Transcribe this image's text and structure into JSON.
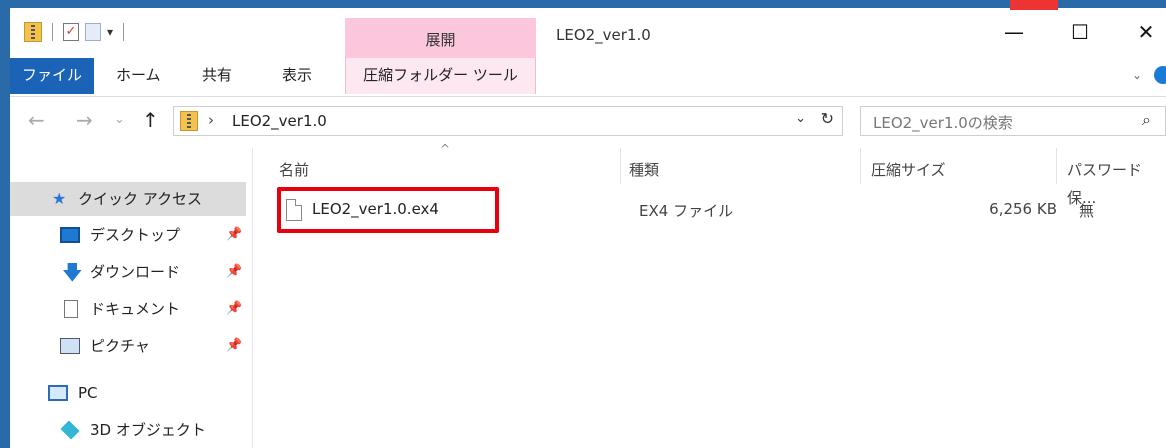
{
  "window": {
    "title": "LEO2_ver1.0",
    "contextual_tab_group": "展開",
    "controls": {
      "minimize": "—",
      "maximize": "☐",
      "close": "✕"
    }
  },
  "quick_access_toolbar": {
    "dropdown": "▾"
  },
  "ribbon": {
    "tabs": [
      {
        "label": "ファイル",
        "active": true
      },
      {
        "label": "ホーム"
      },
      {
        "label": "共有"
      },
      {
        "label": "表示"
      },
      {
        "label": "圧縮フォルダー ツール",
        "contextual": true
      }
    ],
    "collapse": "⌄"
  },
  "address_bar": {
    "back": "←",
    "forward": "→",
    "recent": "⌄",
    "up": "↑",
    "separator": "›",
    "path": "LEO2_ver1.0",
    "dropdown": "⌄",
    "refresh": "↻"
  },
  "search": {
    "placeholder": "LEO2_ver1.0の検索",
    "icon": "⌕"
  },
  "nav_pane": {
    "pin_glyph": "📌",
    "items": [
      {
        "label": "クイック アクセス",
        "icon": "star-icon"
      },
      {
        "label": "デスクトップ",
        "icon": "desktop-icon",
        "pinned": true
      },
      {
        "label": "ダウンロード",
        "icon": "download-icon",
        "pinned": true
      },
      {
        "label": "ドキュメント",
        "icon": "document-icon",
        "pinned": true
      },
      {
        "label": "ピクチャ",
        "icon": "pictures-icon",
        "pinned": true
      },
      {
        "label": "PC",
        "icon": "pc-icon"
      },
      {
        "label": "3D オブジェクト",
        "icon": "3d-objects-icon"
      }
    ]
  },
  "file_list": {
    "sort_indicator": "^",
    "columns": [
      "名前",
      "種類",
      "圧縮サイズ",
      "パスワード保..."
    ],
    "rows": [
      {
        "name": "LEO2_ver1.0.ex4",
        "type": "EX4 ファイル",
        "compressed_size": "6,256 KB",
        "password": "無",
        "highlighted": true
      }
    ]
  },
  "colors": {
    "file_tab": "#1a63b6",
    "context_tab": "#fcc7dc",
    "highlight_border": "#e8000d",
    "desktop_frame": "#2a6aa8"
  }
}
